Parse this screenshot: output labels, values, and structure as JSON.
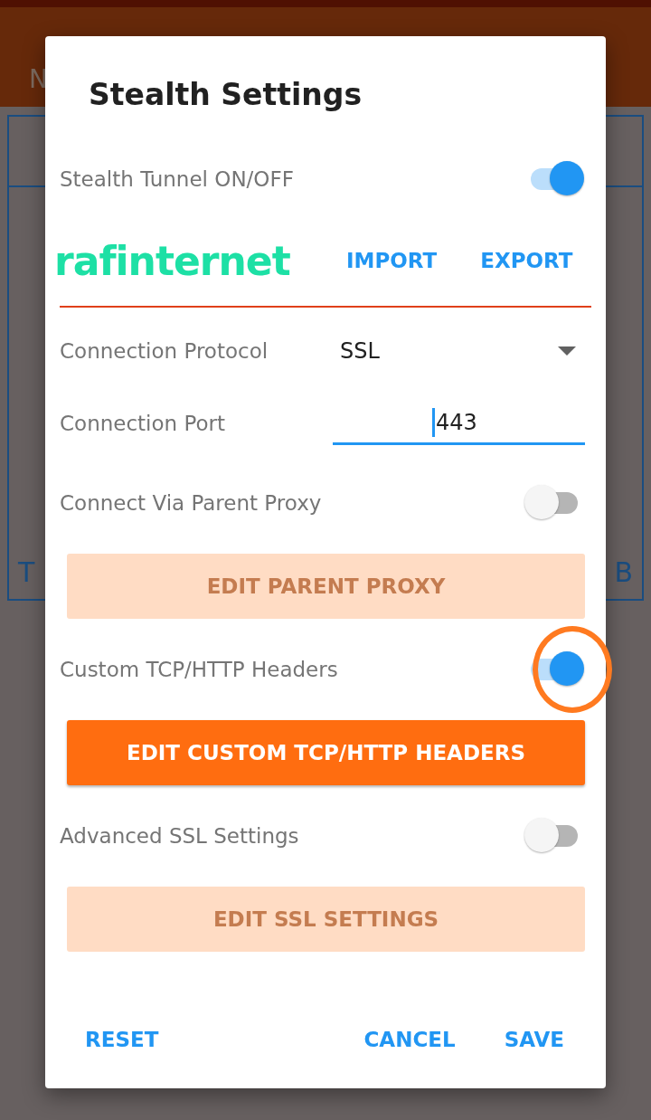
{
  "app_bar": {
    "subtitle": "N"
  },
  "background_panel": {
    "left_label": "T",
    "right_label": "B"
  },
  "dialog": {
    "title": "Stealth Settings",
    "items": [
      {
        "kind": "toggle",
        "label": "Stealth Tunnel ON/OFF",
        "on": true,
        "highlighted": false
      },
      {
        "kind": "logo",
        "logo": "rafinternet",
        "actions": [
          "IMPORT",
          "EXPORT"
        ]
      },
      {
        "kind": "dropdown",
        "label": "Connection Protocol",
        "value": "SSL"
      },
      {
        "kind": "textfield",
        "label": "Connection Port",
        "value": "443",
        "focused": true
      },
      {
        "kind": "toggle",
        "label": "Connect Via Parent Proxy",
        "on": false,
        "highlighted": false
      },
      {
        "kind": "button",
        "label": "EDIT PARENT PROXY",
        "disabled": true
      },
      {
        "kind": "toggle",
        "label": "Custom TCP/HTTP Headers",
        "on": true,
        "highlighted": true
      },
      {
        "kind": "button",
        "label": "EDIT CUSTOM TCP/HTTP HEADERS",
        "disabled": false
      },
      {
        "kind": "toggle",
        "label": "Advanced SSL Settings",
        "on": false,
        "highlighted": false
      },
      {
        "kind": "button",
        "label": "EDIT SSL SETTINGS",
        "disabled": true
      }
    ],
    "footer": {
      "left": [
        "RESET"
      ],
      "right": [
        "CANCEL",
        "SAVE"
      ]
    }
  }
}
